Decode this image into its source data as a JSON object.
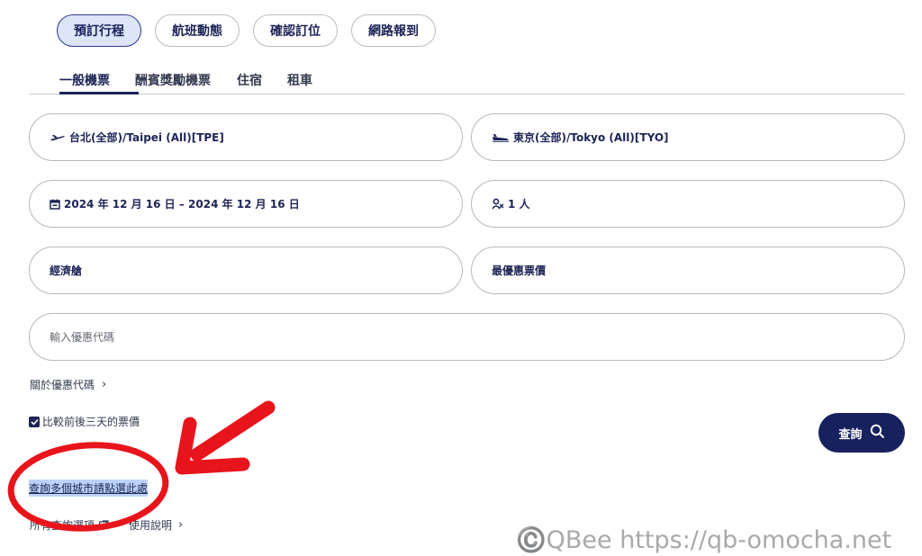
{
  "top_tabs": [
    {
      "label": "預訂行程",
      "active": true
    },
    {
      "label": "航班動態",
      "active": false
    },
    {
      "label": "確認訂位",
      "active": false
    },
    {
      "label": "網路報到",
      "active": false
    }
  ],
  "sub_tabs": [
    {
      "label": "一般機票",
      "active": true
    },
    {
      "label": "酬賓獎勵機票",
      "active": false
    },
    {
      "label": "住宿",
      "active": false
    },
    {
      "label": "租車",
      "active": false
    }
  ],
  "form": {
    "origin": {
      "icon": "plane-takeoff-icon",
      "value": "台北(全部)/Taipei (All)[TPE]"
    },
    "destination": {
      "icon": "plane-landing-icon",
      "value": "東京(全部)/Tokyo (All)[TYO]"
    },
    "dates": {
      "icon": "calendar-icon",
      "value": "2024 年 12 月 16 日 – 2024 年 12 月 16 日"
    },
    "passengers": {
      "icon": "person-icon",
      "value": "1 人"
    },
    "cabin": {
      "value": "經濟艙"
    },
    "fare": {
      "value": "最優惠票價"
    },
    "promo_code": {
      "placeholder": "輸入優惠代碼",
      "value": ""
    }
  },
  "promo_info_link": "關於優惠代碼",
  "compare_checkbox": {
    "label": "比較前後三天的票價",
    "checked": true
  },
  "search_button": {
    "label": "查詢",
    "icon": "search-icon"
  },
  "multi_city_link": "查詢多個城市請點選此處",
  "bottom_links": {
    "all_options": "所有查詢選項",
    "usage": "使用說明"
  },
  "watermark": "©️QBee https://qb-omocha.net",
  "colors": {
    "brand_navy": "#16215e",
    "active_tab_bg": "#dde5f8",
    "annotation_red": "#e8141b",
    "link_highlight": "#bcd3f5"
  }
}
